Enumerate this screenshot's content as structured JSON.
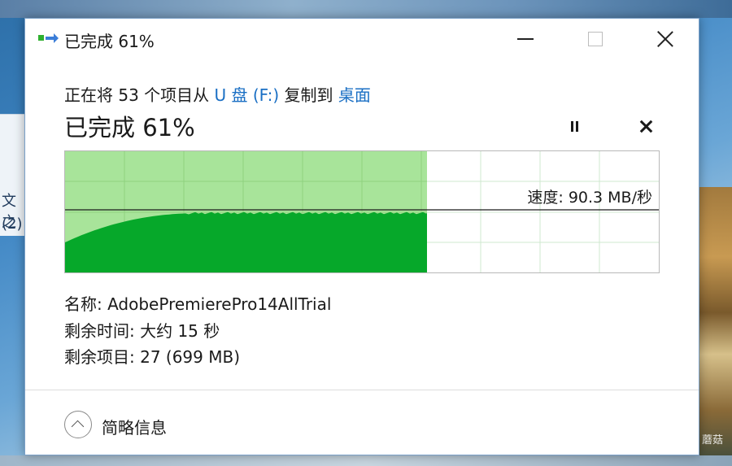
{
  "window": {
    "title": "已完成 61%"
  },
  "description": {
    "prefix": "正在将 53 个项目从 ",
    "source": "U 盘 (F:)",
    "middle": " 复制到 ",
    "destination": "桌面"
  },
  "progress": {
    "heading": "已完成 61%",
    "percent": 61,
    "speed_label": "速度: 90.3 MB/秒"
  },
  "details": {
    "name": "名称: AdobePremierePro14AllTrial",
    "time_remaining": "剩余时间: 大约 15 秒",
    "items_remaining": "剩余项目: 27 (699 MB)"
  },
  "footer": {
    "toggle_label": "简略信息"
  },
  "desktop": {
    "left_text_1": "文之",
    "left_text_2": "(2)",
    "watermark": "蘑菇"
  },
  "colors": {
    "completed_band": "#a8e49a",
    "throughput_fill": "#06a82a",
    "link": "#1a6fc4",
    "grid": "#cfe8cf"
  },
  "icons": {
    "app": "copy-progress-icon",
    "pause": "pause-icon",
    "cancel": "close-icon",
    "toggle": "chevron-up-icon"
  }
}
